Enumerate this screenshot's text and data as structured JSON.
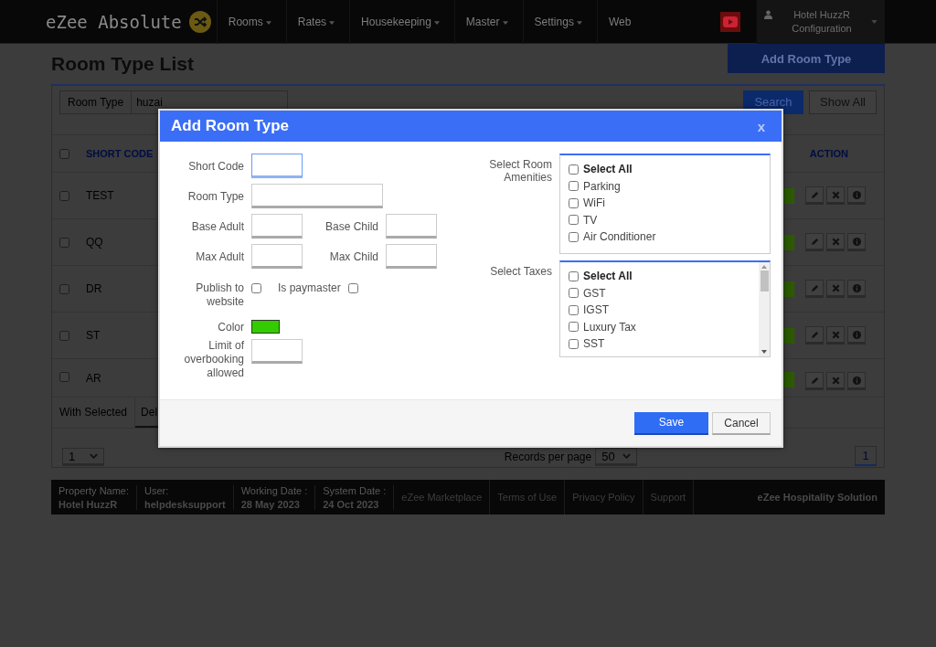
{
  "nav": {
    "logo": "eZee Absolute",
    "menu": [
      {
        "label": "Rooms",
        "dropdown": true
      },
      {
        "label": "Rates",
        "dropdown": true
      },
      {
        "label": "Housekeeping",
        "dropdown": true
      },
      {
        "label": "Master",
        "dropdown": true
      },
      {
        "label": "Settings",
        "dropdown": true
      },
      {
        "label": "Web",
        "dropdown": false
      }
    ],
    "user": {
      "name": "Hotel HuzzR",
      "role": "Configuration"
    }
  },
  "page": {
    "title": "Room Type List",
    "add_button": "Add Room Type"
  },
  "filter": {
    "label": "Room Type",
    "value": "huzai",
    "search_button": "Search",
    "show_all_button": "Show All"
  },
  "table": {
    "select_all": {
      "checked": false
    },
    "columns": [
      "SHORT CODE",
      "ACTION"
    ],
    "rows": [
      {
        "short_code": "TEST",
        "checked": false
      },
      {
        "short_code": "QQ",
        "checked": false
      },
      {
        "short_code": "DR",
        "checked": false
      },
      {
        "short_code": "ST",
        "checked": false
      },
      {
        "short_code": "AR",
        "checked": false
      }
    ]
  },
  "bulk": {
    "label": "With Selected",
    "action": "Del"
  },
  "pagination": {
    "page_select": "1",
    "records_label": "Records per page",
    "records_value": "50",
    "pages": [
      {
        "label": "1",
        "selected": true
      }
    ]
  },
  "footer": {
    "info": [
      {
        "label": "Property Name:",
        "value": "Hotel HuzzR"
      },
      {
        "label": "User:",
        "value": "helpdesksupport"
      },
      {
        "label": "Working Date :",
        "value": "28 May 2023"
      },
      {
        "label": "System Date :",
        "value": "24 Oct 2023"
      }
    ],
    "links": [
      "eZee Marketplace",
      "Terms of Use",
      "Privacy Policy",
      "Support"
    ],
    "brand": "eZee Hospitality Solution"
  },
  "modal": {
    "title": "Add Room Type",
    "close": "x",
    "short_code": {
      "label": "Short Code",
      "focused": true
    },
    "room_type": {
      "label": "Room Type",
      "focused": false
    },
    "base_adult": {
      "label": "Base Adult",
      "focused": false
    },
    "base_child": {
      "label": "Base Child",
      "focused": false
    },
    "max_adult": {
      "label": "Max Adult",
      "focused": false
    },
    "max_child": {
      "label": "Max Child",
      "focused": false
    },
    "publish": {
      "label": "Publish to website",
      "checked": false
    },
    "paymaster": {
      "label": "Is paymaster",
      "checked": false
    },
    "color": {
      "label": "Color",
      "color": "#33cc00"
    },
    "overbooking": {
      "label": "Limit of overbooking allowed",
      "focused": false
    },
    "amenities": {
      "label": "Select Room Amenities",
      "options": [
        {
          "label": "Select All",
          "kind": "all",
          "checked": false
        },
        {
          "label": "Parking",
          "kind": "item",
          "checked": false
        },
        {
          "label": "WiFi",
          "kind": "item",
          "checked": false
        },
        {
          "label": "TV",
          "kind": "item",
          "checked": false
        },
        {
          "label": "Air Conditioner",
          "kind": "item",
          "checked": false
        }
      ]
    },
    "taxes": {
      "label": "Select Taxes",
      "options": [
        {
          "label": "Select All",
          "kind": "all",
          "checked": false
        },
        {
          "label": "GST",
          "kind": "item",
          "checked": false
        },
        {
          "label": "IGST",
          "kind": "item",
          "checked": false
        },
        {
          "label": "Luxury Tax",
          "kind": "item",
          "checked": false
        },
        {
          "label": "SST",
          "kind": "item",
          "checked": false
        }
      ]
    },
    "save_button": "Save",
    "cancel_button": "Cancel"
  }
}
